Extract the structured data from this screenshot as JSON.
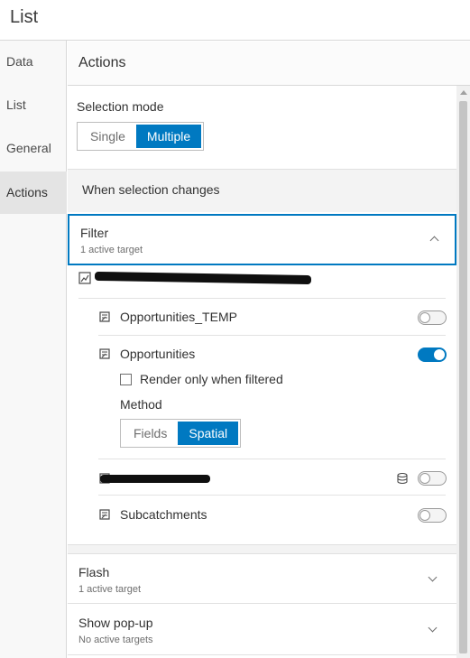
{
  "window": {
    "title": "List"
  },
  "nav": {
    "items": [
      {
        "label": "Data",
        "active": false
      },
      {
        "label": "List",
        "active": false
      },
      {
        "label": "General",
        "active": false
      },
      {
        "label": "Actions",
        "active": true
      }
    ]
  },
  "panel": {
    "title": "Actions"
  },
  "selection_mode": {
    "label": "Selection mode",
    "options": [
      "Single",
      "Multiple"
    ],
    "selected": "Multiple"
  },
  "when_selection_changes": {
    "label": "When selection changes"
  },
  "filter": {
    "title": "Filter",
    "subtitle": "1 active target",
    "expanded": true,
    "layers": [
      {
        "name": "Opportunities_TEMP",
        "enabled": false
      },
      {
        "name": "Opportunities",
        "enabled": true
      },
      {
        "name": "Subcatchments",
        "enabled": false
      }
    ],
    "render_only_when_filtered": {
      "label": "Render only when filtered",
      "checked": false
    },
    "method": {
      "label": "Method",
      "options": [
        "Fields",
        "Spatial"
      ],
      "selected": "Spatial"
    }
  },
  "flash": {
    "title": "Flash",
    "subtitle": "1 active target"
  },
  "show_popup": {
    "title": "Show pop-up",
    "subtitle": "No active targets"
  },
  "colors": {
    "accent": "#0079c1",
    "toggle_off": "#f4f4f4",
    "nav_active": "#e4e4e4"
  },
  "icons": [
    "layer-icon",
    "chevron-up-icon",
    "chevron-down-icon",
    "database-icon",
    "map-source-icon"
  ]
}
